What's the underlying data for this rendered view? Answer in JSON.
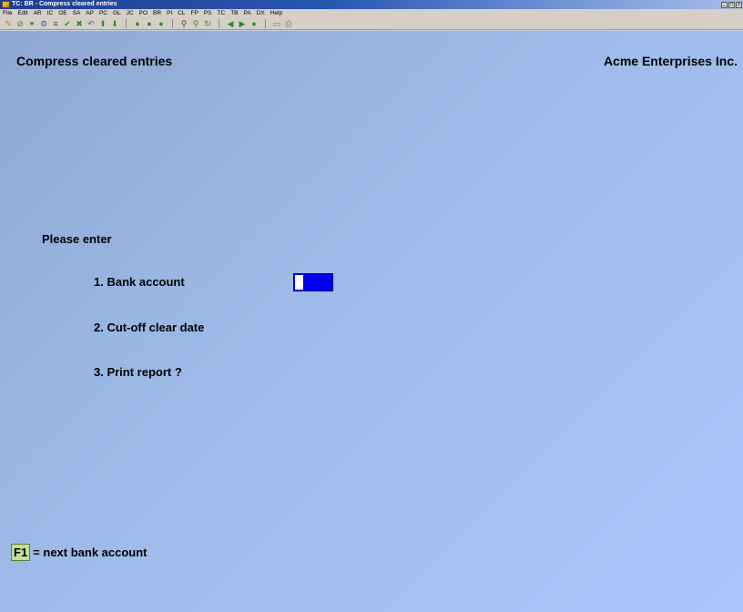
{
  "window": {
    "title": "TC: BR - Compress cleared entries",
    "controls": [
      "_",
      "□",
      "x"
    ]
  },
  "menu": [
    "File",
    "Edit",
    "AR",
    "IC",
    "OE",
    "SA",
    "AP",
    "PC",
    "GL",
    "JC",
    "PO",
    "BR",
    "PI",
    "CL",
    "FP",
    "PS",
    "TC",
    "TB",
    "PA",
    "DX",
    "Help"
  ],
  "toolbar": {
    "icons": [
      {
        "name": "open-icon",
        "glyph": "✎",
        "color": "#b8860b"
      },
      {
        "name": "stop-icon",
        "glyph": "⊘",
        "color": "#2e8b2e"
      },
      {
        "name": "tools-icon",
        "glyph": "✦",
        "color": "#6a6a6a"
      },
      {
        "name": "settings-icon",
        "glyph": "⚙",
        "color": "#3a5fb0"
      },
      {
        "name": "list-icon",
        "glyph": "≡",
        "color": "#505050"
      },
      {
        "name": "check-icon",
        "glyph": "✔",
        "color": "#2e8b2e"
      },
      {
        "name": "cancel-icon",
        "glyph": "✖",
        "color": "#2e8b2e"
      },
      {
        "name": "undo-icon",
        "glyph": "↶",
        "color": "#2e6bb0"
      },
      {
        "name": "up-arrow-icon",
        "glyph": "⬆",
        "color": "#2e8b2e"
      },
      {
        "name": "down-arrow-icon",
        "glyph": "⬇",
        "color": "#2e8b2e"
      },
      {
        "name": "sep"
      },
      {
        "name": "circle-icon",
        "glyph": "●",
        "color": "#2e8b2e"
      },
      {
        "name": "circle-icon",
        "glyph": "●",
        "color": "#2e8b2e"
      },
      {
        "name": "circle-icon",
        "glyph": "●",
        "color": "#2e8b2e"
      },
      {
        "name": "sep"
      },
      {
        "name": "binoculars-icon",
        "glyph": "⚲",
        "color": "#404040"
      },
      {
        "name": "zoom-icon",
        "glyph": "⚲",
        "color": "#2e8b2e"
      },
      {
        "name": "refresh-icon",
        "glyph": "↻",
        "color": "#2e8b2e"
      },
      {
        "name": "sep"
      },
      {
        "name": "prev-icon",
        "glyph": "◀",
        "color": "#2e8b2e"
      },
      {
        "name": "next-icon",
        "glyph": "▶",
        "color": "#2e8b2e"
      },
      {
        "name": "record-icon",
        "glyph": "●",
        "color": "#2e8b2e"
      },
      {
        "name": "sep"
      },
      {
        "name": "window-icon",
        "glyph": "▭",
        "color": "#707070"
      },
      {
        "name": "printer-icon",
        "glyph": "⎙",
        "color": "#707070"
      }
    ]
  },
  "screen": {
    "title": "Compress cleared entries",
    "company": "Acme Enterprises Inc.",
    "prompt": "Please enter",
    "fields": [
      {
        "label": "1. Bank account"
      },
      {
        "label": "2. Cut-off clear date"
      },
      {
        "label": "3. Print report ?"
      }
    ]
  },
  "hint": {
    "key": "F1",
    "text": "= next bank account"
  },
  "colors": {
    "input_field": "#0000ee",
    "fkey_box": "#c4dd9a"
  }
}
